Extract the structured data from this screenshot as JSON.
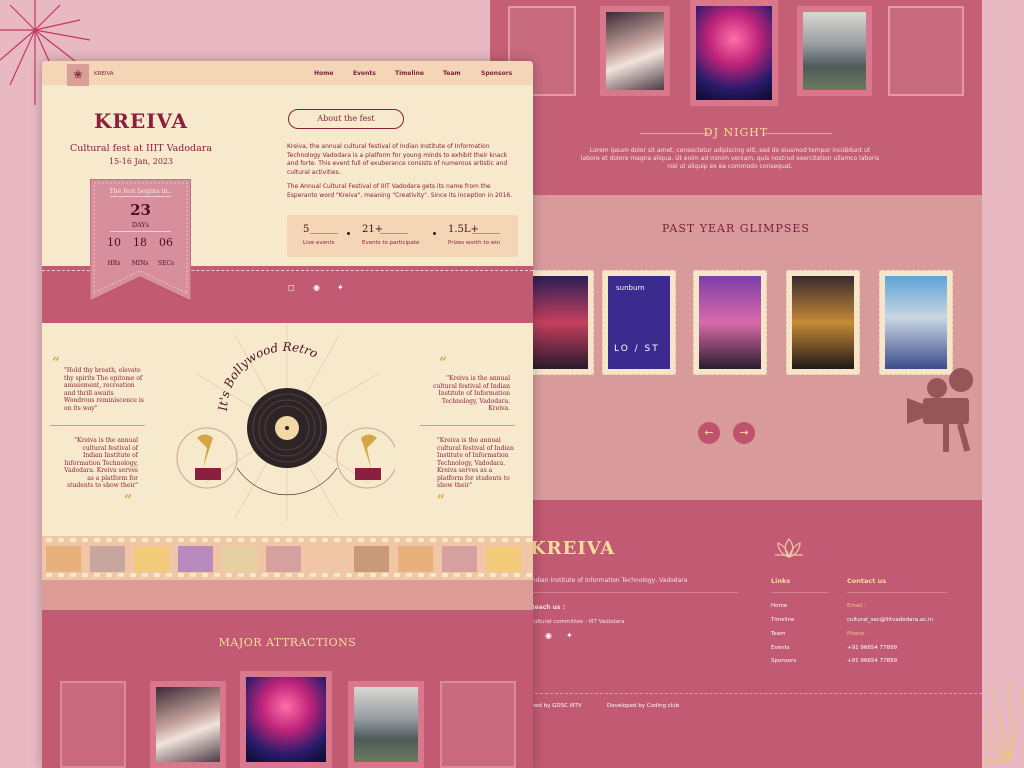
{
  "site": {
    "brand": "KREIVA",
    "nav": [
      "Home",
      "Events",
      "Timeline",
      "Team",
      "Sponsors"
    ]
  },
  "hero": {
    "title": "KREIVA",
    "subtitle": "Cultural fest at IIIT Vadodara",
    "dates": "15-16 Jan, 2023",
    "countdown": {
      "caption": "The fest begins in..",
      "days_value": "23",
      "days_label": "DAYs",
      "hours_value": "10",
      "hours_label": "HRs",
      "mins_value": "18",
      "mins_label": "MINs",
      "secs_value": "06",
      "secs_label": "SECs"
    }
  },
  "about": {
    "heading": "About the fest",
    "para1": "Kreiva, the annual cultural festival of Indian Institute of Information Technology Vadodara is a platform for young minds to exhibit their knack and forte. This event full of exuberance consists of numerous artistic and cultural activities.",
    "para2": "The Annual Cultural Festival of IIIT Vadodara gets its name from the Esperanto word \"Kreiva\", meaning \"Creativity\". Since its inception in 2016.",
    "stats": [
      {
        "value": "5",
        "label": "Live events"
      },
      {
        "value": "21+",
        "label": "Events to participate"
      },
      {
        "value": "1.5L+",
        "label": "Prizes worth to win"
      }
    ]
  },
  "theme": {
    "title": "It's Bollywood Retro",
    "quotes": [
      "\"Hold thy breath, elevate thy spirits The epitome of amusement, recreation and thrill awaits Wondrous reminiscence is on its way\"",
      "\"Kreiva is the annual cultural festival of Indian Institute of Information Technology, Vadodara. Kreiva serves as a platform for students to show their\"",
      "\"Kreiva is the annual cultural festival of Indian Institute of Information Technology, Vadodara. Kreiva.",
      "\"Kreiva is the annual cultural festival of Indian Institute of Information Technology, Vadodara. Kreiva serves as a platform for students to show their\""
    ]
  },
  "attractions": {
    "title": "MAJOR ATTRACTIONS"
  },
  "dj": {
    "title": "DJ NIGHT",
    "text": "Lorem ipsum dolor sit amet, consectetur adipiscing elit, sed do eiusmod tempor incididunt ut labore et dolore magna aliqua. Ut enim ad minim veniam, quis nostrud exercitation ullamco laboris nisi ut aliquip ex ea commodo consequat."
  },
  "glimpses": {
    "title": "PAST YEAR GLIMPSES",
    "stamp_text": [
      "sunburn",
      "LO / ST"
    ]
  },
  "footer": {
    "brand": "KREIVA",
    "institute": "Indian Institute of Information Technology, Vadodara",
    "reach_label": "Reach us :",
    "committee": "Cultural committee - IIIT Vadodara",
    "links_heading": "Links",
    "links": [
      "Home",
      "Timeline",
      "Team",
      "Events",
      "Sponsors"
    ],
    "contact_heading": "Contact us",
    "email_label": "Email :",
    "email": "cultural_sec@iiitvadodara.ac.in",
    "phone_label": "Phone :",
    "phones": [
      "+91 96654 77899",
      "+91 96654 77899"
    ],
    "designed_by": "Designed by GDSC IIITV",
    "developed_by": "Developed by Coding club"
  },
  "colors": {
    "maroon": "#8a1f3e",
    "rose": "#c15a72",
    "cream": "#f7e9cc",
    "gold": "#f6df9a"
  },
  "icons": [
    "instagram-icon",
    "facebook-icon",
    "twitter-icon",
    "lotus-icon",
    "gramophone-icon",
    "vinyl-record-icon",
    "film-camera-icon",
    "arrow-left-icon",
    "arrow-right-icon",
    "quote-icon"
  ]
}
